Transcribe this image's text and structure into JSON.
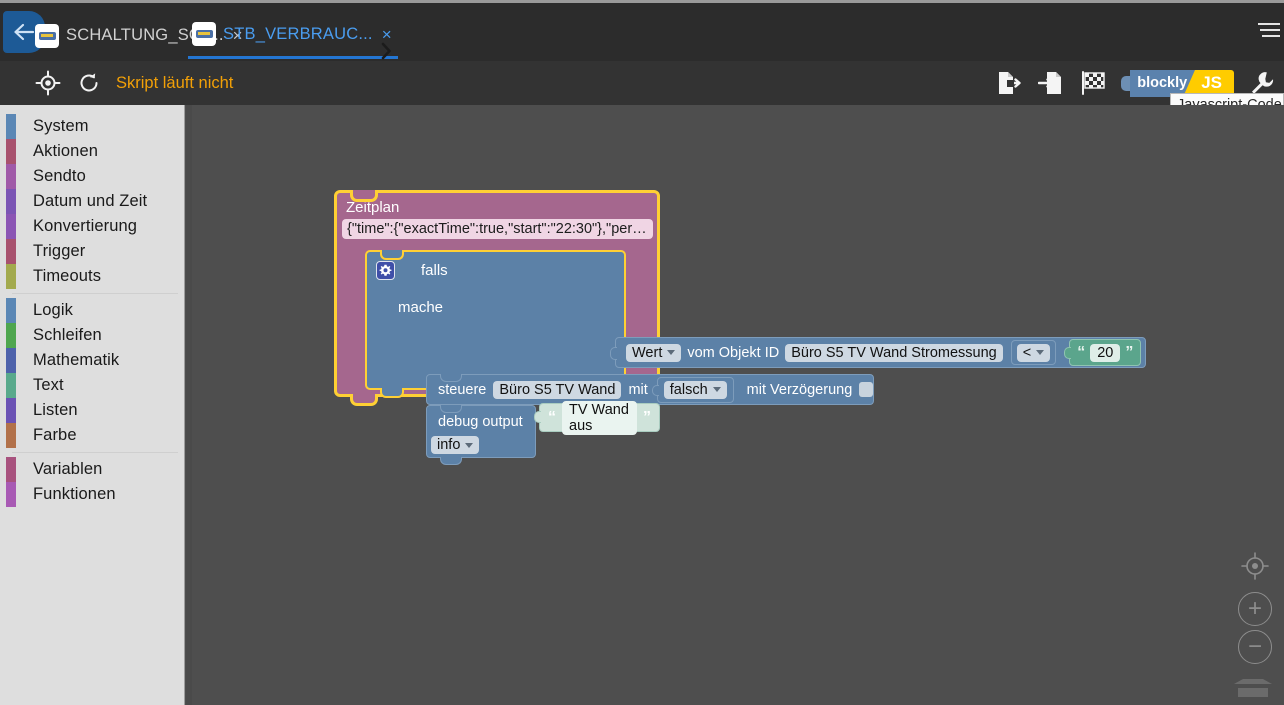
{
  "window": {
    "menu_icon": "hamburger-icon"
  },
  "tabbar": {
    "back_icon": "back-arrow-icon",
    "scroll_next_icon": "chevron-right-icon",
    "tabs": [
      {
        "label": "SCHALTUNG_SON..",
        "close": "×",
        "icon": "blockly-file-icon",
        "active": false
      },
      {
        "label": "STB_VERBRAUC...",
        "close": "×",
        "icon": "blockly-file-icon",
        "active": true
      }
    ]
  },
  "toolbar": {
    "locate_icon": "crosshair-target-icon",
    "restart_icon": "restart-circular-arrow-icon",
    "run_state": "Skript läuft nicht",
    "export_icon": "export-file-icon",
    "import_icon": "import-file-icon",
    "checkered_flag_icon": "checkered-flag-icon",
    "lang_blockly": "blockly",
    "lang_js": "JS",
    "settings_icon": "wrench-icon",
    "tooltip": "Javascript-Code anze"
  },
  "toolbox": {
    "groups": [
      {
        "items": [
          {
            "label": "System",
            "color": "#5b87b5"
          },
          {
            "label": "Aktionen",
            "color": "#a8526e"
          },
          {
            "label": "Sendto",
            "color": "#a05aa8"
          },
          {
            "label": "Datum und Zeit",
            "color": "#7b55b4"
          },
          {
            "label": "Konvertierung",
            "color": "#8b55b4"
          },
          {
            "label": "Trigger",
            "color": "#a8526e"
          },
          {
            "label": "Timeouts",
            "color": "#a3aa4e"
          }
        ]
      },
      {
        "items": [
          {
            "label": "Logik",
            "color": "#5b87b5"
          },
          {
            "label": "Schleifen",
            "color": "#4fa64f"
          },
          {
            "label": "Mathematik",
            "color": "#4e62ab"
          },
          {
            "label": "Text",
            "color": "#59a98c"
          },
          {
            "label": "Listen",
            "color": "#6b52b4"
          },
          {
            "label": "Farbe",
            "color": "#b2714a"
          }
        ]
      },
      {
        "items": [
          {
            "label": "Variablen",
            "color": "#a8527e"
          },
          {
            "label": "Funktionen",
            "color": "#a85ab4"
          }
        ]
      }
    ]
  },
  "workspace": {
    "blocks": {
      "schedule": {
        "title": "Zeitplan",
        "value": "{\"time\":{\"exactTime\":true,\"start\":\"22:30\"},\"peri…",
        "color": "#a5678e",
        "selected_outline": "#ffd034"
      },
      "if_block": {
        "gear_icon": "gear-icon",
        "if_label": "falls",
        "do_label": "mache",
        "color": "#5c81a7"
      },
      "condition": {
        "value_type": "Wert",
        "from_label": "vom Objekt ID",
        "object_id": "Büro S5 TV Wand Stromessung",
        "operator": "<",
        "compare_value": "20",
        "quote_open": "“",
        "quote_close": "”"
      },
      "control": {
        "verb": "steuere",
        "target": "Büro S5 TV Wand",
        "with_label": "mit",
        "state": "falsch",
        "delay_label": "mit Verzögerung",
        "delay_checked": false
      },
      "debug": {
        "label": "debug output",
        "severity": "info",
        "message": "TV Wand aus",
        "quote_open": "“",
        "quote_close": "”"
      }
    },
    "controls": {
      "center_icon": "center-target-icon",
      "zoom_in": "+",
      "zoom_out": "−",
      "trash_icon": "trash-can-icon"
    }
  }
}
